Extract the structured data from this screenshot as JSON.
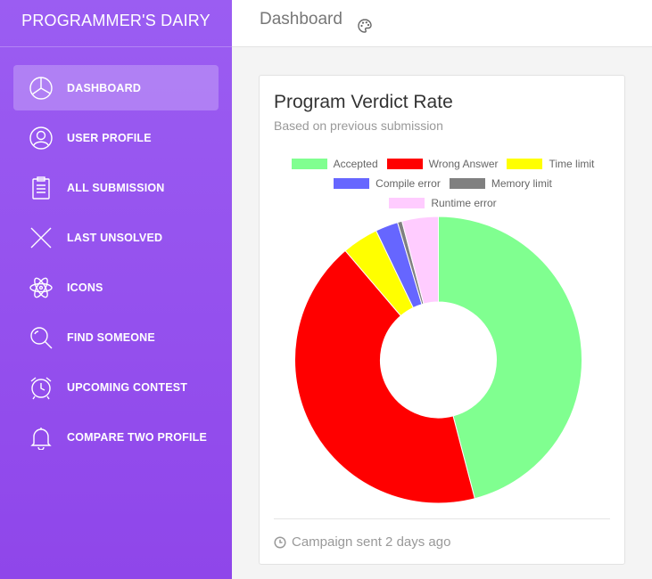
{
  "sidebar": {
    "brand": "PROGRAMMER'S DAIRY",
    "items": [
      {
        "label": "DASHBOARD",
        "icon": "pie-chart-icon",
        "active": true
      },
      {
        "label": "USER PROFILE",
        "icon": "user-icon"
      },
      {
        "label": "ALL SUBMISSION",
        "icon": "clipboard-icon"
      },
      {
        "label": "LAST UNSOLVED",
        "icon": "x-icon"
      },
      {
        "label": "ICONS",
        "icon": "atom-icon"
      },
      {
        "label": "FIND SOMEONE",
        "icon": "search-icon"
      },
      {
        "label": "UPCOMING CONTEST",
        "icon": "alarm-clock-icon"
      },
      {
        "label": "COMPARE TWO PROFILE",
        "icon": "bell-icon"
      }
    ]
  },
  "header": {
    "title": "Dashboard",
    "icon": "palette-icon"
  },
  "card": {
    "title": "Program Verdict Rate",
    "subtitle": "Based on previous submission",
    "footer": "Campaign sent 2 days ago",
    "footer_icon": "clock-icon"
  },
  "chart_data": {
    "type": "pie",
    "variant": "doughnut",
    "title": "Program Verdict Rate",
    "legend_position": "top",
    "categories": [
      "Accepted",
      "Wrong Answer",
      "Time limit",
      "Compile error",
      "Memory limit",
      "Runtime error"
    ],
    "values": [
      45,
      42,
      4,
      2.5,
      0.5,
      4
    ],
    "colors": [
      "#80ff90",
      "#ff0000",
      "#ffff00",
      "#6666ff",
      "#808080",
      "#ffccff"
    ]
  }
}
